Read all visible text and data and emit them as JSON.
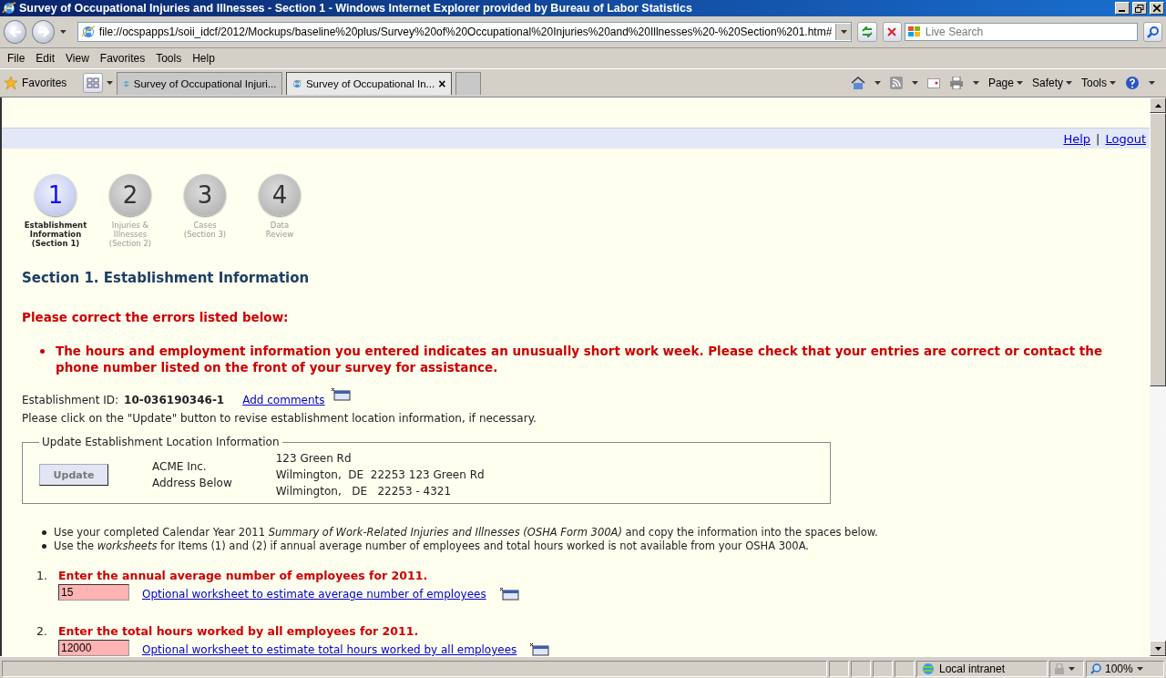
{
  "window": {
    "title": "Survey of Occupational Injuries and Illnesses - Section 1 - Windows Internet Explorer provided by Bureau of Labor Statistics"
  },
  "address_bar": {
    "url": "file://ocspapps1/soii_idcf/2012/Mockups/baseline%20plus/Survey%20of%20Occupational%20Injuries%20and%20Illnesses%20-%20Section%201.htm#"
  },
  "search": {
    "placeholder": "Live Search"
  },
  "menu": [
    "File",
    "Edit",
    "View",
    "Favorites",
    "Tools",
    "Help"
  ],
  "favorites_label": "Favorites",
  "tabs": [
    {
      "label": "Survey of Occupational Injuri...",
      "selected": false
    },
    {
      "label": "Survey of Occupational In...",
      "selected": true,
      "close": "×"
    }
  ],
  "command_bar": [
    "Page",
    "Safety",
    "Tools"
  ],
  "top_links": {
    "help": "Help",
    "separator": "|",
    "logout": "Logout"
  },
  "steps": [
    {
      "number": "1",
      "label": "Establishment\nInformation\n(Section 1)",
      "selected": true
    },
    {
      "number": "2",
      "label": "Injuries &\nIllnesses\n(Section 2)",
      "selected": false
    },
    {
      "number": "3",
      "label": "Cases\n(Section 3)",
      "selected": false
    },
    {
      "number": "4",
      "label": "Data\nReview",
      "selected": false
    }
  ],
  "heading": "Section 1. Establishment Information",
  "error_title": "Please correct the errors listed below:",
  "errors": [
    "The hours and employment information you entered indicates an unusually short work week. Please check that your entries are correct or contact the phone number listed on the front of your survey for assistance."
  ],
  "establishment": {
    "label": "Establishment ID:",
    "id": "10-036190346-1",
    "comments_link": "Add comments"
  },
  "instruction": "Please click on the \"Update\" button to revise establishment location information, if necessary.",
  "location": {
    "legend": "Update Establishment Location Information",
    "button": "Update",
    "disabled": true,
    "company": "ACME Inc.",
    "address_note": "Address Below",
    "address_lines": [
      "123 Green Rd",
      "Wilmington,  DE  22253 123 Green Rd",
      "Wilmington,   DE   22253 - 4321"
    ]
  },
  "notes": [
    "Use your completed Calendar Year 2011 *Summary of Work-Related Injuries and Illnesses (OSHA Form 300A)* and copy the information into the spaces below.",
    "Use the *worksheets* for Items (1) and (2) if annual average number of employees and total hours worked is not available from your OSHA 300A."
  ],
  "questions": [
    {
      "number": "1.",
      "text": "Enter the annual average number of employees for 2011.",
      "value": "15",
      "error": true,
      "link": "Optional worksheet to estimate average number of employees"
    },
    {
      "number": "2.",
      "text": "Enter the total hours worked by all employees for 2011.",
      "value": "12000",
      "error": true,
      "link": "Optional worksheet to estimate total hours worked by all employees"
    }
  ],
  "status_bar": {
    "zone": "Local intranet",
    "zoom": "100%"
  }
}
